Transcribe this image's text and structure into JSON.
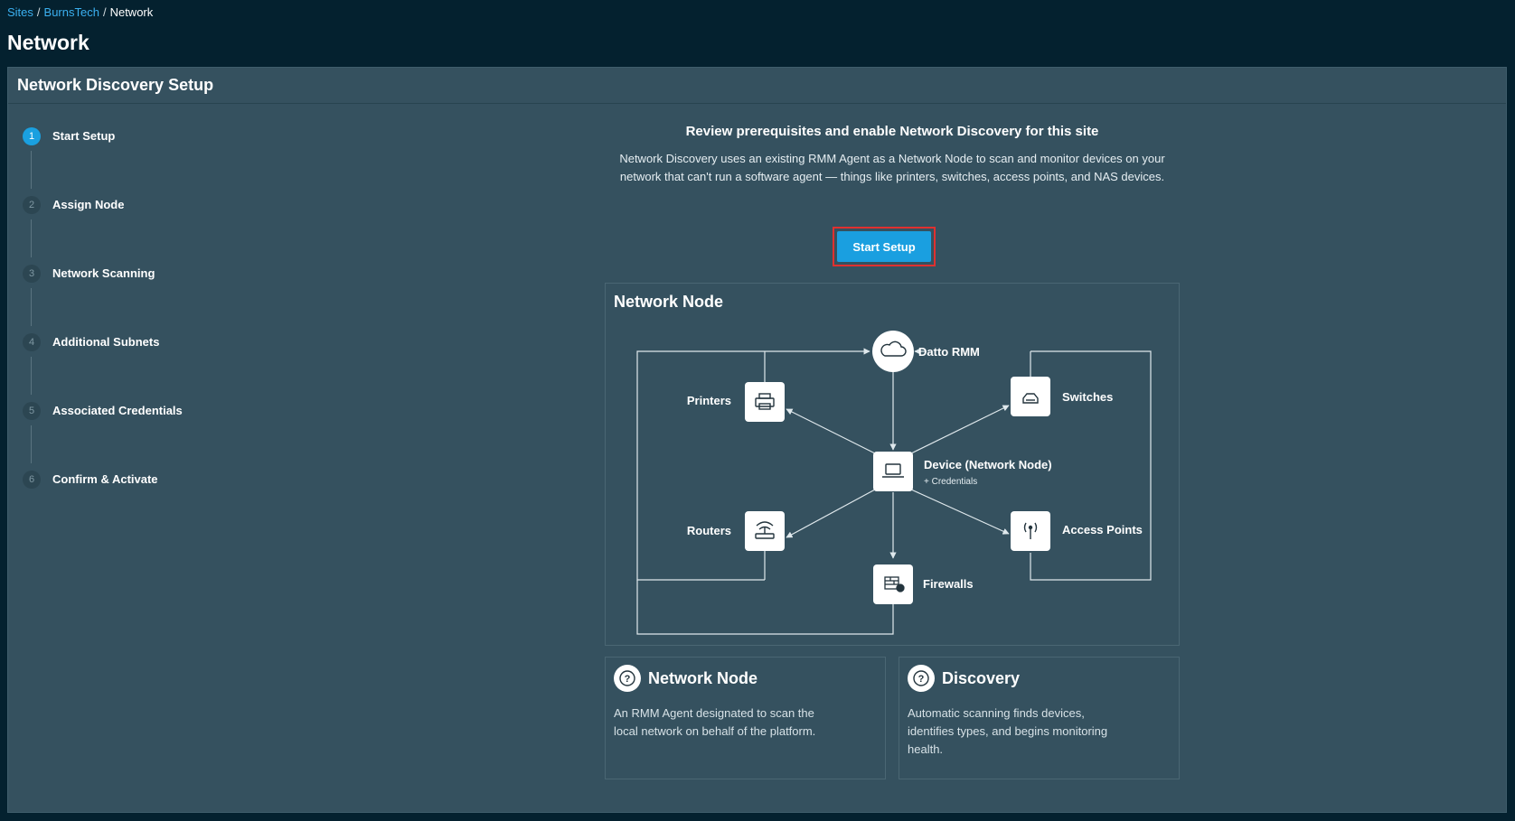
{
  "breadcrumb": {
    "sites": "Sites",
    "site": "BurnsTech",
    "current": "Network",
    "separator": "/"
  },
  "page": {
    "title": "Network"
  },
  "panel": {
    "title": "Network Discovery Setup"
  },
  "steps": [
    {
      "num": "1",
      "label": "Start Setup",
      "active": true
    },
    {
      "num": "2",
      "label": "Assign Node"
    },
    {
      "num": "3",
      "label": "Network Scanning"
    },
    {
      "num": "4",
      "label": "Additional Subnets"
    },
    {
      "num": "5",
      "label": "Associated Credentials"
    },
    {
      "num": "6",
      "label": "Confirm & Activate"
    }
  ],
  "intro": {
    "heading": "Review prerequisites and enable Network Discovery for this site",
    "body": "Network Discovery uses an existing RMM Agent as a Network Node to scan and monitor devices on your network that can't run a software agent — things like printers, switches, access points, and NAS devices.",
    "button": "Start Setup"
  },
  "diagram": {
    "title": "Network Node",
    "nodes": {
      "datto": "Datto RMM",
      "printers": "Printers",
      "switches": "Switches",
      "device": "Device (Network Node)",
      "device_sub": "+ Credentials",
      "routers": "Routers",
      "access_points": "Access Points",
      "firewalls": "Firewalls"
    }
  },
  "info": [
    {
      "title": "Network Node",
      "desc": "An RMM Agent designated to scan the local network on behalf of the platform."
    },
    {
      "title": "Discovery",
      "desc": "Automatic scanning finds devices, identifies types, and begins monitoring health."
    }
  ],
  "colors": {
    "accent": "#1aa0e0",
    "highlight": "#e0302f",
    "panel": "#35515f",
    "background": "#04212f"
  }
}
